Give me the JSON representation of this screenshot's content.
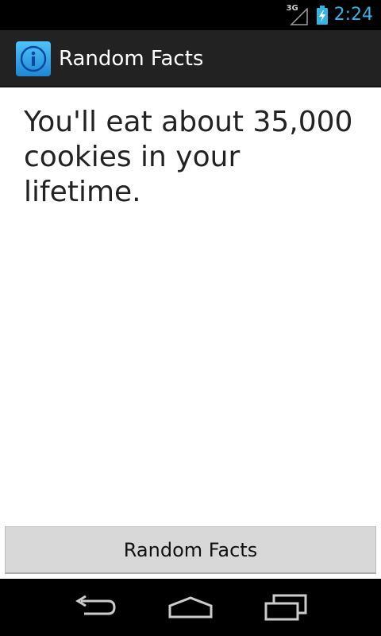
{
  "status_bar": {
    "network_label": "3G",
    "clock": "2:24",
    "icons": [
      "signal-icon",
      "battery-charging-icon"
    ],
    "clock_color": "#33b5e5"
  },
  "action_bar": {
    "icon": "info-icon",
    "title": "Random Facts",
    "background": "#222222"
  },
  "main": {
    "fact": "You'll eat about 35,000 cookies in your lifetime.",
    "button_label": "Random Facts"
  },
  "nav_bar": {
    "items": [
      "back-icon",
      "home-icon",
      "recent-apps-icon"
    ]
  }
}
